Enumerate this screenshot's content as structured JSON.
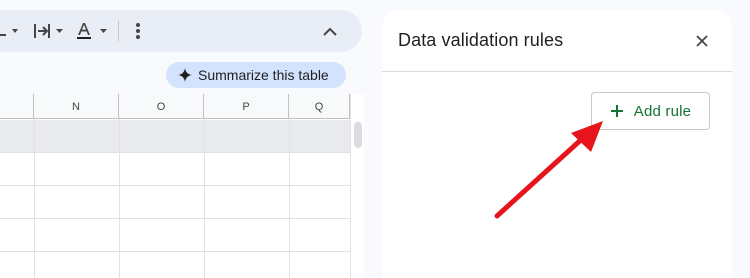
{
  "sheet": {
    "columns": [
      "N",
      "O",
      "P",
      "Q"
    ],
    "summarize_chip": {
      "label": "Summarize this table",
      "icon": "sparkle-icon"
    }
  },
  "toolbar": {
    "icons": [
      "text-wrap-icon",
      "text-rotation-icon",
      "text-color-icon",
      "more-vert-icon",
      "chevron-up-icon"
    ]
  },
  "panel": {
    "title": "Data validation rules",
    "close_icon": "close-icon",
    "add_rule": {
      "label": "Add rule",
      "icon": "plus-icon"
    }
  },
  "colors": {
    "accent_green": "#137333",
    "chip_blue": "#d3e3fd",
    "annotation_red": "#e8141b"
  }
}
